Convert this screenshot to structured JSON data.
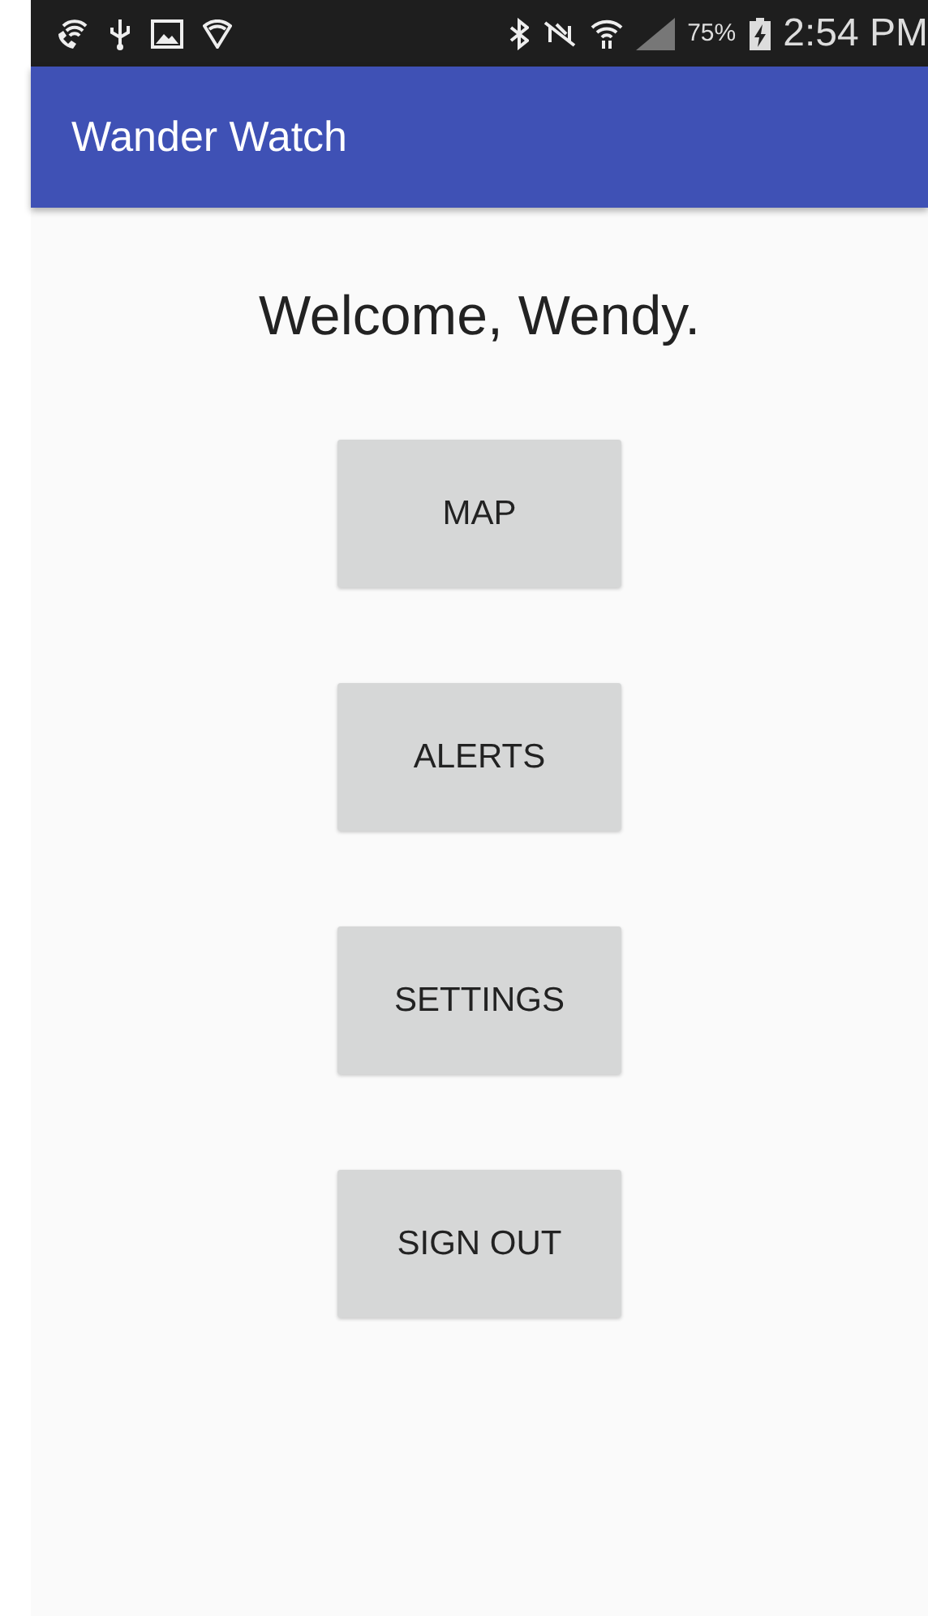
{
  "status_bar": {
    "battery_text": "75%",
    "time": "2:54 PM"
  },
  "app_bar": {
    "title": "Wander Watch"
  },
  "greeting": "Welcome, Wendy.",
  "buttons": [
    {
      "label": "MAP"
    },
    {
      "label": "ALERTS"
    },
    {
      "label": "SETTINGS"
    },
    {
      "label": "SIGN OUT"
    }
  ]
}
